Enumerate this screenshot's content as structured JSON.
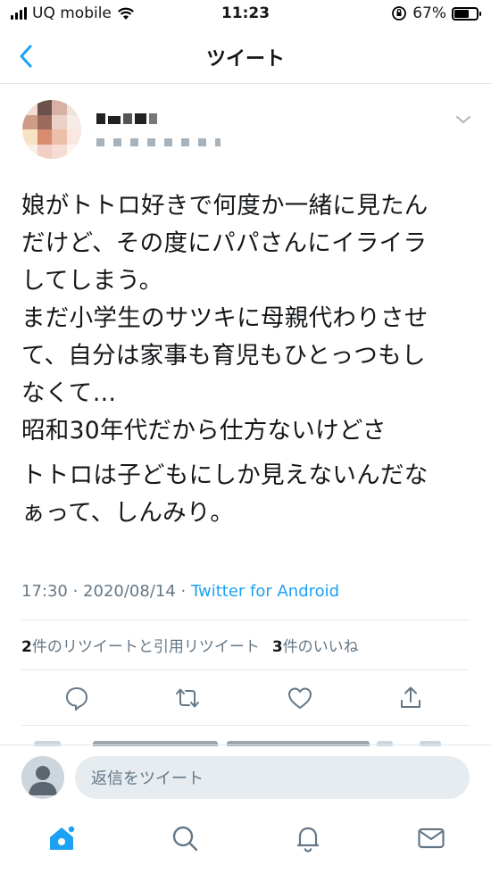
{
  "status_bar": {
    "carrier": "UQ mobile",
    "time": "11:23",
    "battery": "67%",
    "battery_level": 0.67
  },
  "nav": {
    "title": "ツイート"
  },
  "tweet": {
    "paragraphs": [
      "娘がトトロ好きで何度か一緒に見たん\nだけど、その度にパパさんにイライラ\nしてしまう。\nまだ小学生のサツキに母親代わりさせ\nて、自分は家事も育児もひとっつもし\nなくて…\n昭和30年代だから仕方ないけどさ",
      "トトロは子どもにしか見えないんだな\nぁって、しんみり。"
    ],
    "time": "17:30",
    "date": "2020/08/14",
    "source": "Twitter for Android",
    "retweet_count": "2",
    "retweet_label": "件のリツイートと引用リツイート",
    "like_count": "3",
    "like_label": "件のいいね"
  },
  "actions": [
    "reply-icon",
    "retweet-icon",
    "like-icon",
    "share-icon"
  ],
  "reply_bar": {
    "placeholder": "返信をツイート"
  },
  "tabs": [
    "home-icon",
    "search-icon",
    "notifications-icon",
    "messages-icon"
  ],
  "colors": {
    "accent": "#1da1f2",
    "secondary_text": "#657786",
    "divider": "#e1e8ed"
  }
}
